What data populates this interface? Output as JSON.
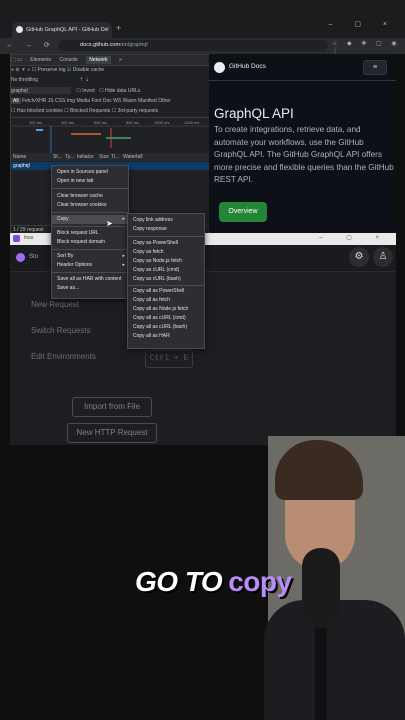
{
  "browser": {
    "tab_title": "GitHub GraphQL API - GitHub Do",
    "tab_close": "×",
    "new_tab": "+",
    "window_controls": "– ▢ ×",
    "nav_buttons": "← → ⟳ ⌂",
    "url_host": "docs.github.com",
    "url_path": "/en/graphql"
  },
  "devtools": {
    "tabs": [
      "Elements",
      "Console",
      "Network",
      "»"
    ],
    "active_tab": "Network",
    "preserve_log": "Preserve log",
    "disable_cache": "Disable cache",
    "throttling": "No throttling",
    "filter_value": "graphql",
    "invert": "Invert",
    "hide_data_urls": "Hide data URLs",
    "types": [
      "All",
      "Fetch/XHR",
      "JS",
      "CSS",
      "Img",
      "Media",
      "Font",
      "Doc",
      "WS",
      "Wasm",
      "Manifest",
      "Other"
    ],
    "blocked_cookies": "Has blocked cookies",
    "blocked_requests": "Blocked Requests",
    "third_party": "3rd-party requests",
    "timeline_ticks": [
      "200 ms",
      "400 ms",
      "600 ms",
      "800 ms",
      "1000 ms",
      "1200 ms"
    ],
    "columns": [
      "Name",
      "St...",
      "Ty...",
      "Initiator",
      "Size",
      "Ti...",
      "Waterfall"
    ],
    "row_name": "graphql",
    "status_bar": "1 / 29 request"
  },
  "context_menu": {
    "items": [
      "Open in Sources panel",
      "Open in new tab",
      "Clear browser cache",
      "Clear browser cookies",
      "Copy",
      "Block request URL",
      "Block request domain",
      "Sort By",
      "Header Options",
      "Save all as HAR with content",
      "Save as..."
    ]
  },
  "copy_submenu": {
    "items": [
      "Copy link address",
      "Copy response",
      "Copy as PowerShell",
      "Copy as fetch",
      "Copy as Node.js fetch",
      "Copy as cURL (cmd)",
      "Copy as cURL (bash)",
      "Copy all as PowerShell",
      "Copy all as fetch",
      "Copy all as Node.js fetch",
      "Copy all as cURL (cmd)",
      "Copy all as cURL (bash)",
      "Copy all as HAR"
    ]
  },
  "github_docs": {
    "brand": "GitHub Docs",
    "menu_icon": "≡",
    "title": "GraphQL API",
    "intro": "To create integrations, retrieve data, and automate your workflows, use the GitHub GraphQL API. The GitHub GraphQL API offers more precise and flexible queries than the GitHub REST API.",
    "overview_button": "Overview"
  },
  "app": {
    "window_title": "Inso",
    "app_name": "Sto",
    "window_controls": "– ▢ ×",
    "new_request": "New Request",
    "switch_requests": "Switch Requests",
    "edit_environments": "Edit Environments",
    "shortcut": "Ctrl + E",
    "import_button": "Import from File",
    "new_http_button": "New HTTP Request"
  },
  "caption": {
    "white_part": "GO TO",
    "purple_part": "copy"
  },
  "colors": {
    "accent_purple": "#b98df7",
    "github_green": "#238636",
    "devtools_selection": "#0e3a66"
  }
}
